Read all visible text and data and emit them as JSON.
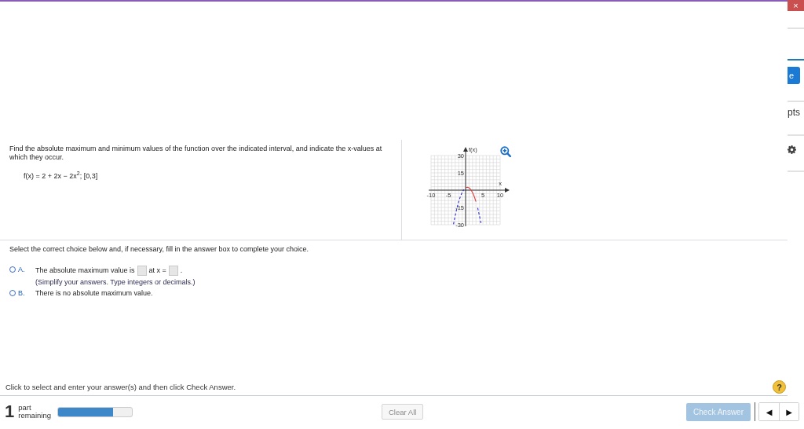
{
  "close_button": {
    "label": "×"
  },
  "background_page": {
    "button_label": "e",
    "points_label": "pts"
  },
  "question": {
    "prompt": "Find the absolute maximum and minimum values of the function over the indicated interval, and indicate the x-values at which they occur.",
    "function": "f(x) = 2 + 2x − 2x$^{2}$; [0,3]"
  },
  "graph": {
    "chart_data": {
      "type": "line",
      "grid": true,
      "xlabel": "x",
      "ylabel": "f(x)",
      "xlim": [
        -10,
        10
      ],
      "ylim": [
        -30,
        30
      ],
      "xticks": [
        -10,
        -5,
        5,
        10
      ],
      "yticks": [
        -30,
        -15,
        15,
        30
      ],
      "x": [
        -3.5,
        -3,
        -2.5,
        -2,
        -1.5,
        -1,
        -0.5,
        0,
        0.5,
        1,
        1.5,
        2,
        2.5,
        3,
        3.5,
        4,
        4.5
      ],
      "series": [
        {
          "color": "#2a2ae0",
          "line_style": "dashed",
          "values": [
            -29.5,
            -22,
            -15.5,
            -10,
            -5.5,
            -2,
            0.5,
            null,
            null,
            null,
            null,
            null,
            null,
            null,
            -15.5,
            -22,
            -29.5
          ]
        },
        {
          "color": "#e23a3a",
          "line_style": "solid",
          "values": [
            null,
            null,
            null,
            null,
            null,
            null,
            null,
            2,
            2.5,
            2,
            0.5,
            -2,
            -5.5,
            -10,
            null,
            null,
            null
          ]
        }
      ]
    }
  },
  "instruction": "Select the correct choice below and, if necessary, fill in the answer box to complete your choice.",
  "choices": [
    {
      "letter": "A.",
      "selected": false,
      "kind": "fill_in",
      "parts": [
        {
          "kind": "text",
          "text": "The absolute maximum value is"
        },
        {
          "kind": "blank"
        },
        {
          "kind": "text",
          "text": "at x ="
        },
        {
          "kind": "blank"
        },
        {
          "kind": "text",
          "text": "."
        }
      ],
      "hint": "(Simplify your answers. Type integers or decimals.)"
    },
    {
      "letter": "B.",
      "selected": false,
      "kind": "text",
      "text": "There is no absolute maximum value."
    }
  ],
  "status_message": "Click to select and enter your answer(s) and then click Check Answer.",
  "help_label": "?",
  "footer": {
    "parts_count": "1",
    "parts_word": "part",
    "remaining_word": "remaining",
    "progress": {
      "level": 0.74
    },
    "clear_button": "Clear All",
    "check_button": {
      "label": "Check Answer",
      "disabled": true
    },
    "prev_label": "◀",
    "next_label": "▶"
  }
}
